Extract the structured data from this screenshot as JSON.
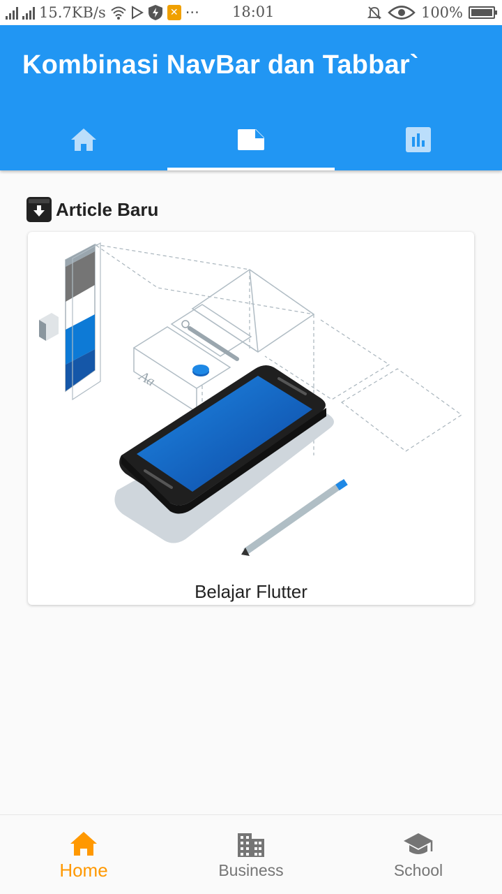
{
  "status_bar": {
    "net_speed": "15.7KB/s",
    "time": "18:01",
    "battery": "100%"
  },
  "app_bar": {
    "title": "Kombinasi NavBar dan Tabbar`",
    "tabs": [
      {
        "icon": "home-icon",
        "selected": false
      },
      {
        "icon": "note-icon",
        "selected": true
      },
      {
        "icon": "chart-icon",
        "selected": false
      }
    ]
  },
  "section": {
    "icon": "archive-icon",
    "title": "Article Baru"
  },
  "card": {
    "image_alt": "phone-illustration",
    "caption": "Belajar Flutter"
  },
  "bottom_nav": {
    "items": [
      {
        "label": "Home",
        "icon": "home-icon",
        "active": true
      },
      {
        "label": "Business",
        "icon": "business-icon",
        "active": false
      },
      {
        "label": "School",
        "icon": "school-icon",
        "active": false
      }
    ]
  },
  "colors": {
    "primary": "#2196f3",
    "accent": "#ff9800",
    "inactive": "#757575"
  }
}
